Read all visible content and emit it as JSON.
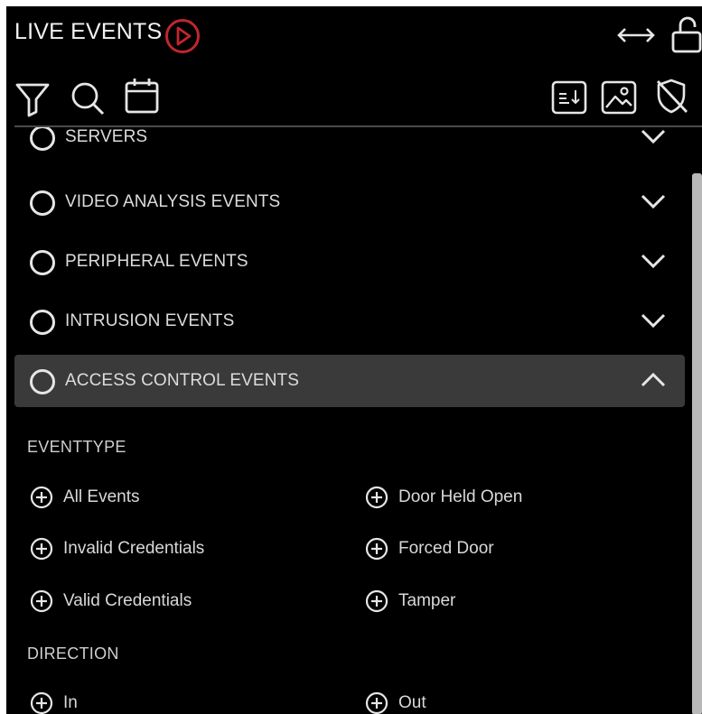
{
  "header": {
    "title": "LIVE EVENTS",
    "accent_color": "#c0262d",
    "icons": [
      "play-icon",
      "resize-horizontal-icon",
      "unlock-icon"
    ]
  },
  "toolbar": {
    "left_icons": [
      "filter-icon",
      "search-icon",
      "calendar-icon"
    ],
    "right_icons": [
      "export-icon",
      "image-icon",
      "shield-off-icon"
    ]
  },
  "categories": [
    {
      "label": "SERVERS",
      "state": "collapsed",
      "partially_visible": true
    },
    {
      "label": "VIDEO ANALYSIS EVENTS",
      "state": "collapsed"
    },
    {
      "label": "PERIPHERAL EVENTS",
      "state": "collapsed"
    },
    {
      "label": "INTRUSION EVENTS",
      "state": "collapsed"
    },
    {
      "label": "ACCESS CONTROL EVENTS",
      "state": "expanded"
    }
  ],
  "access_control": {
    "eventtype_label": "EVENTTYPE",
    "eventtype_options": [
      "All Events",
      "Door Held Open",
      "Invalid Credentials",
      "Forced Door",
      "Valid Credentials",
      "Tamper"
    ],
    "direction_label": "DIRECTION",
    "direction_options": [
      "In",
      "Out"
    ]
  }
}
